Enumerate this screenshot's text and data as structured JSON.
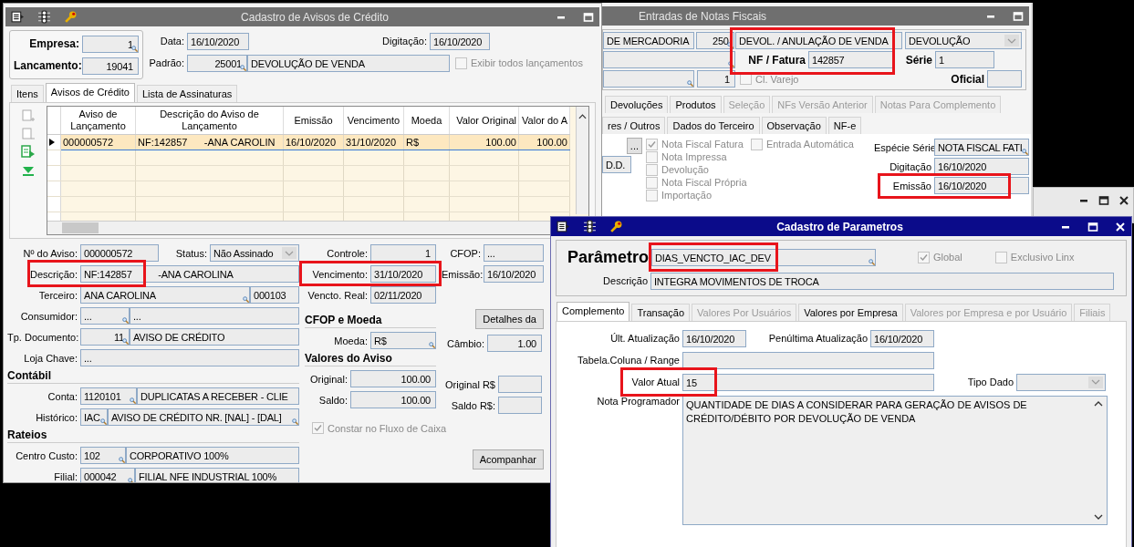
{
  "credit_window": {
    "title": "Cadastro de Avisos de Crédito",
    "empresa": {
      "label": "Empresa:",
      "value": "1"
    },
    "lancamento": {
      "label": "Lancamento:",
      "value": "19041"
    },
    "data": {
      "label": "Data:",
      "value": "16/10/2020"
    },
    "digitacao": {
      "label": "Digitação:",
      "value": "16/10/2020"
    },
    "padrao": {
      "label": "Padrão:",
      "code": "25001",
      "value": "DEVOLUÇÃO DE VENDA"
    },
    "show_all": {
      "label": "Exibir todos lançamentos",
      "checked": false,
      "disabled": true
    },
    "tabs": [
      {
        "label": "Itens",
        "selected": false
      },
      {
        "label": "Avisos de Crédito",
        "selected": true
      },
      {
        "label": "Lista de Assinaturas",
        "selected": false
      }
    ],
    "grid": {
      "columns": [
        "Aviso de Lançamento",
        "Descrição do Aviso de Lançamento",
        "Emissão",
        "Vencimento",
        "Moeda",
        "Valor Original",
        "Valor do A"
      ],
      "rows": [
        {
          "selected": true,
          "cells": [
            "000000572",
            "NF:142857      -ANA CAROLIN",
            "16/10/2020",
            "31/10/2020",
            "R$",
            "100.00",
            "100.00"
          ]
        }
      ]
    },
    "numero": {
      "label": "Nº do Aviso:",
      "value": "000000572"
    },
    "status": {
      "label": "Status:",
      "value": "Não Assinado"
    },
    "descricao": {
      "label": "Descrição:",
      "value": "NF:142857          -ANA CAROLINA",
      "highlighted": true
    },
    "terceiro": {
      "label": "Terceiro:",
      "value": "ANA CAROLINA",
      "code": "000103"
    },
    "consumidor": {
      "label": "Consumidor:",
      "code": "...",
      "value": "..."
    },
    "tp_documento": {
      "label": "Tp. Documento:",
      "code": "11",
      "value": "AVISO DE CRÉDITO"
    },
    "loja_chave": {
      "label": "Loja Chave:",
      "value": "..."
    },
    "contabil_heading": "Contábil",
    "conta": {
      "label": "Conta:",
      "code": "1120101",
      "value": "DUPLICATAS A RECEBER - CLIE"
    },
    "historico": {
      "label": "Histórico:",
      "code": "IAC",
      "value": "AVISO DE CRÉDITO NR. [NAL] - [DAL]"
    },
    "rateios_heading": "Rateios",
    "centro_custo": {
      "label": "Centro Custo:",
      "code": "102",
      "value": "CORPORATIVO 100%"
    },
    "filial": {
      "label": "Filial:",
      "code": "000042",
      "value": "FILIAL NFE INDUSTRIAL 100%"
    },
    "controle": {
      "label": "Controle:",
      "value": "1"
    },
    "vencimento": {
      "label": "Vencimento:",
      "value": "31/10/2020",
      "highlighted": true
    },
    "vencto_real": {
      "label": "Vencto. Real:",
      "value": "02/11/2020"
    },
    "cfop_moeda_heading": "CFOP e Moeda",
    "moeda": {
      "label": "Moeda:",
      "value": "R$"
    },
    "valores_heading": "Valores do Aviso",
    "original": {
      "label": "Original:",
      "value": "100.00"
    },
    "saldo": {
      "label": "Saldo:",
      "value": "100.00"
    },
    "fluxo": {
      "label": "Constar no Fluxo de Caixa",
      "checked": true,
      "disabled": true
    },
    "cfop": {
      "label": "CFOP:",
      "value": "..."
    },
    "emissao": {
      "label": "Emissão:",
      "value": "16/10/2020"
    },
    "detalhes_button": "Detalhes da",
    "cambio": {
      "label": "Câmbio:",
      "value": "1.00"
    },
    "original_rs": {
      "label": "Original  R$"
    },
    "saldo_rs": {
      "label": "Saldo R$:"
    },
    "acompanhar_button": "Acompanhar"
  },
  "invoice_window": {
    "title": "Entradas de Notas Fiscais",
    "operacao": {
      "value": "DE MERCADORIA"
    },
    "codigo": {
      "value": "250"
    },
    "natureza": {
      "value": "DEVOL. / ANULAÇÃO DE VENDA"
    },
    "tipo": {
      "value": "DEVOLUÇÃO"
    },
    "nf_fatura": {
      "label": "NF / Fatura",
      "value": "142857",
      "highlighted": true
    },
    "serie": {
      "label": "Série",
      "value": "1"
    },
    "filial_code": {
      "value": "1"
    },
    "cl_varejo": {
      "label": "Cl. Varejo",
      "checked": false,
      "disabled": true
    },
    "oficial": {
      "label": "Oficial"
    },
    "tabs_top": [
      {
        "label": "Devoluções",
        "disabled": false
      },
      {
        "label": "Produtos",
        "disabled": false
      },
      {
        "label": "Seleção",
        "disabled": true
      },
      {
        "label": "NFs Versão Anterior",
        "disabled": true
      },
      {
        "label": "Notas Para Complemento",
        "disabled": true
      }
    ],
    "tabs_bottom": [
      {
        "label": "res / Outros",
        "selected": false
      },
      {
        "label": "Dados do Terceiro",
        "selected": false
      },
      {
        "label": "Observação",
        "selected": false
      },
      {
        "label": "NF-e",
        "selected": false
      }
    ],
    "more_button": "...",
    "dd_field": "D.D.",
    "checks": [
      {
        "label": "Nota Fiscal Fatura",
        "checked": true,
        "disabled": true
      },
      {
        "label": "Nota Impressa",
        "checked": false,
        "disabled": true
      },
      {
        "label": "Devolução",
        "checked": false,
        "disabled": true
      },
      {
        "label": "Nota Fiscal Própria",
        "checked": false,
        "disabled": true
      },
      {
        "label": "Importação",
        "checked": false,
        "disabled": true
      }
    ],
    "entrada_automatica": {
      "label": "Entrada Automática",
      "checked": false,
      "disabled": true
    },
    "especie": {
      "label": "Espécie Série",
      "value": "NOTA FISCAL FATI"
    },
    "digitacao": {
      "label": "Digitação",
      "value": "16/10/2020"
    },
    "emissao": {
      "label": "Emissão",
      "value": "16/10/2020",
      "highlighted": true
    }
  },
  "parameter_window": {
    "title": "Cadastro de Parametros",
    "parametro": {
      "label": "Parâmetro",
      "value": "DIAS_VENCTO_IAC_DEV",
      "highlighted": true
    },
    "global": {
      "label": "Global",
      "checked": true,
      "disabled": true
    },
    "exclusivo": {
      "label": "Exclusivo Linx",
      "checked": false,
      "disabled": true
    },
    "descricao": {
      "label": "Descrição",
      "value": "INTEGRA MOVIMENTOS DE TROCA"
    },
    "tabs": [
      {
        "label": "Complemento",
        "selected": true,
        "disabled": false
      },
      {
        "label": "Transação",
        "selected": false,
        "disabled": false
      },
      {
        "label": "Valores Por Usuários",
        "selected": false,
        "disabled": true
      },
      {
        "label": "Valores por Empresa",
        "selected": false,
        "disabled": false
      },
      {
        "label": "Valores por Empresa e por Usuário",
        "selected": false,
        "disabled": true
      },
      {
        "label": "Filiais",
        "selected": false,
        "disabled": true
      }
    ],
    "ult_atualizacao": {
      "label": "Últ. Atualização",
      "value": "16/10/2020"
    },
    "penultima": {
      "label": "Penúltima Atualização",
      "value": "16/10/2020"
    },
    "tabela": {
      "label": "Tabela.Coluna / Range"
    },
    "valor_atual": {
      "label": "Valor Atual",
      "value": "15",
      "highlighted": true
    },
    "tipo_dado": {
      "label": "Tipo Dado"
    },
    "nota": {
      "label": "Nota Programador",
      "value": "QUANTIDADE DE DIAS A CONSIDERAR PARA GERAÇÃO DE AVISOS DE CRÉDITO/DÉBITO POR DEVOLUÇÃO DE VENDA"
    }
  }
}
